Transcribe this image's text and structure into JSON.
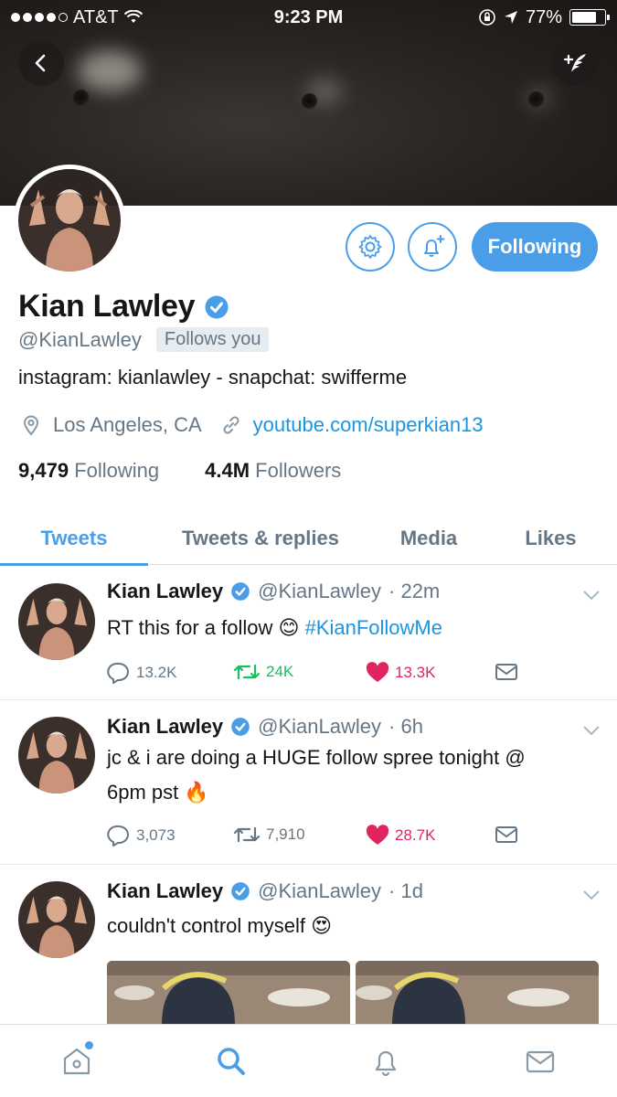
{
  "statusbar": {
    "carrier": "AT&T",
    "time": "9:23 PM",
    "battery": "77%",
    "battery_level": 0.77
  },
  "header": {
    "back_icon": "chevron-left-icon",
    "compose_icon": "compose-tweet-icon"
  },
  "profile": {
    "name": "Kian Lawley",
    "handle": "@KianLawley",
    "follows_you": "Follows you",
    "bio": "instagram: kianlawley - snapchat: swifferme",
    "location": "Los Angeles, CA",
    "website": "youtube.com/superkian13",
    "following_count": "9,479",
    "following_label": "Following",
    "followers_count": "4.4M",
    "followers_label": "Followers",
    "follow_button": "Following"
  },
  "tabs": [
    "Tweets",
    "Tweets & replies",
    "Media",
    "Likes"
  ],
  "tweets": [
    {
      "name": "Kian Lawley",
      "handle": "@KianLawley",
      "time": "· 22m",
      "text": "RT this for a follow",
      "emoji": "😊",
      "hashtag": "#KianFollowMe",
      "replies": "13.2K",
      "retweets": "24K",
      "likes": "13.3K"
    },
    {
      "name": "Kian Lawley",
      "handle": "@KianLawley",
      "time": "· 6h",
      "text": "jc & i are doing a HUGE follow spree tonight @",
      "text_line2": "6pm pst",
      "emoji": "🔥",
      "replies": "3,073",
      "retweets": "7,910",
      "likes": "28.7K"
    },
    {
      "name": "Kian Lawley",
      "handle": "@KianLawley",
      "time": "· 1d",
      "text": "couldn't control myself",
      "emoji": "😍"
    }
  ],
  "colors": {
    "accent": "#4a9ee8",
    "link": "#1b95e0",
    "retweet": "#17bf63",
    "like": "#e0245e",
    "muted": "#657786"
  },
  "nav": [
    "home-icon",
    "search-icon",
    "notifications-icon",
    "messages-icon"
  ]
}
